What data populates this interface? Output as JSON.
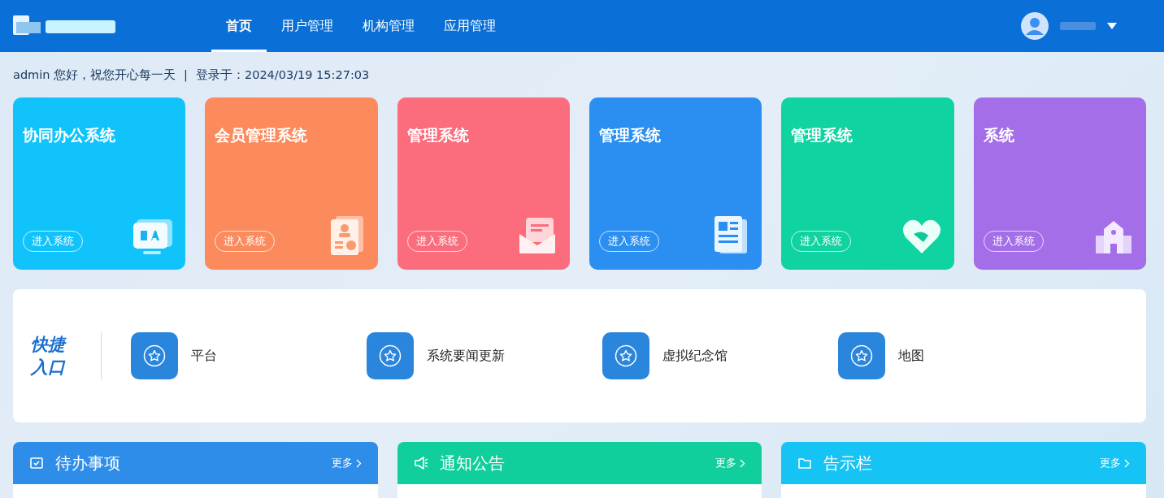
{
  "nav": {
    "tabs": [
      {
        "label": "首页",
        "selected": true
      },
      {
        "label": "用户管理",
        "selected": false
      },
      {
        "label": "机构管理",
        "selected": false
      },
      {
        "label": "应用管理",
        "selected": false
      }
    ]
  },
  "welcome": {
    "greeting": "admin 您好，祝您开心每一天",
    "separator": "|",
    "login": "登录于：2024/03/19 15:27:03"
  },
  "systems": [
    {
      "title": "协同办公系统",
      "button": "进入系统",
      "color": "#10c4fb",
      "kind": "oa"
    },
    {
      "title": "会员管理系统",
      "button": "进入系统",
      "color": "#fb8a5c",
      "kind": "card"
    },
    {
      "title": "管理系统",
      "button": "进入系统",
      "color": "#fb6c7c",
      "kind": "mail"
    },
    {
      "title": "管理系统",
      "button": "进入系统",
      "color": "#2a8ff0",
      "kind": "news"
    },
    {
      "title": "管理系统",
      "button": "进入系统",
      "color": "#0fd3a0",
      "kind": "heart"
    },
    {
      "title": "系统",
      "button": "进入系统",
      "color": "#a46ee8",
      "kind": "building"
    }
  ],
  "quick": {
    "title": "快捷入口",
    "items": [
      {
        "label": "平台"
      },
      {
        "label": "系统要闻更新"
      },
      {
        "label": "虚拟纪念馆"
      },
      {
        "label": "地图"
      }
    ]
  },
  "panels": [
    {
      "title": "待办事项",
      "more": "更多",
      "color": "#2e8de8",
      "kind": "check"
    },
    {
      "title": "通知公告",
      "more": "更多",
      "color": "#10cf9c",
      "kind": "speaker"
    },
    {
      "title": "告示栏",
      "more": "更多",
      "color": "#16c3f5",
      "kind": "folder"
    }
  ]
}
